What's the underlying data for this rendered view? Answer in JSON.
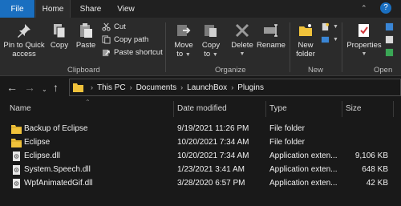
{
  "tabs": {
    "file": "File",
    "home": "Home",
    "share": "Share",
    "view": "View"
  },
  "ribbon": {
    "clipboard": {
      "label": "Clipboard",
      "pin_line1": "Pin to Quick",
      "pin_line2": "access",
      "copy": "Copy",
      "paste": "Paste",
      "cut": "Cut",
      "copy_path": "Copy path",
      "paste_shortcut": "Paste shortcut"
    },
    "organize": {
      "label": "Organize",
      "move_to": "Move",
      "move_to_2": "to",
      "copy_to": "Copy",
      "copy_to_2": "to",
      "delete": "Delete",
      "rename": "Rename"
    },
    "new": {
      "label": "New",
      "new_folder_1": "New",
      "new_folder_2": "folder"
    },
    "open": {
      "label": "Open",
      "properties": "Properties"
    }
  },
  "address": {
    "segments": [
      "This PC",
      "Documents",
      "LaunchBox",
      "Plugins"
    ]
  },
  "columns": {
    "name": "Name",
    "date": "Date modified",
    "type": "Type",
    "size": "Size"
  },
  "files": [
    {
      "name": "Backup of Eclipse",
      "date": "9/19/2021 11:26 PM",
      "type": "File folder",
      "size": "",
      "kind": "folder"
    },
    {
      "name": "Eclipse",
      "date": "10/20/2021 7:34 AM",
      "type": "File folder",
      "size": "",
      "kind": "folder"
    },
    {
      "name": "Eclipse.dll",
      "date": "10/20/2021 7:34 AM",
      "type": "Application exten...",
      "size": "9,106 KB",
      "kind": "dll"
    },
    {
      "name": "System.Speech.dll",
      "date": "1/23/2021 3:41 AM",
      "type": "Application exten...",
      "size": "648 KB",
      "kind": "dll"
    },
    {
      "name": "WpfAnimatedGif.dll",
      "date": "3/28/2020 6:57 PM",
      "type": "Application exten...",
      "size": "42 KB",
      "kind": "dll"
    }
  ],
  "colors": {
    "accent": "#1a6fc0",
    "folder": "#f0c23b",
    "background": "#191919",
    "ribbon": "#2b2b2b"
  }
}
